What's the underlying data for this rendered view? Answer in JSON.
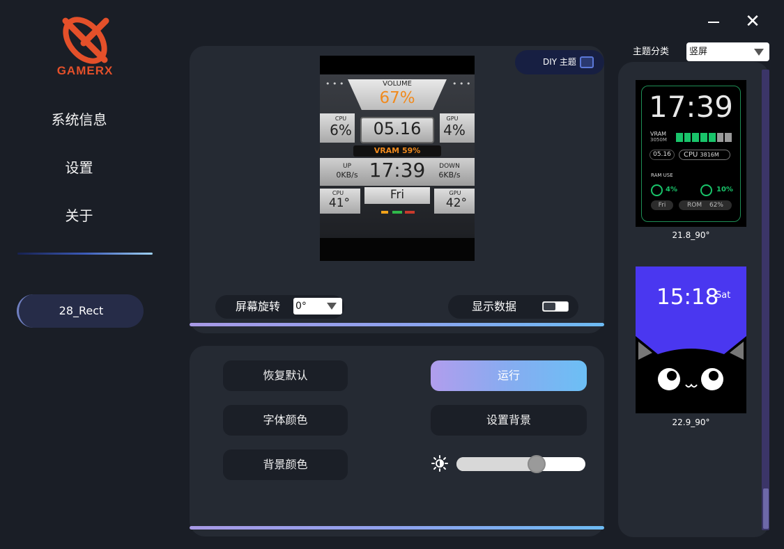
{
  "brand": {
    "name": "GAMERX",
    "color": "#e4502a"
  },
  "nav": {
    "items": [
      {
        "label": "系统信息"
      },
      {
        "label": "设置"
      },
      {
        "label": "关于"
      }
    ],
    "device": "28_Rect"
  },
  "window": {
    "minimize_icon": "minimize-icon",
    "close_icon": "close-icon",
    "close_glyph": "✕"
  },
  "preview": {
    "diy_label": "DIY 主题",
    "screen": {
      "volume_label": "VOLUME",
      "volume_value": "67%",
      "cpu_label": "CPU",
      "cpu_value": "6%",
      "date": "05.16",
      "gpu_label": "GPU",
      "gpu_value": "4%",
      "vram": "VRAM 59%",
      "up_label": "UP",
      "up_value": "0KB/s",
      "time": "17:39",
      "down_label": "DOWN",
      "down_value": "6KB/s",
      "cpu_temp_label": "CPU",
      "cpu_temp": "41°",
      "day": "Fri",
      "gpu_temp_label": "GPU",
      "gpu_temp": "42°"
    },
    "rotation_label": "屏幕旋转",
    "rotation_value": "0°",
    "show_data_label": "显示数据",
    "show_data_on": false
  },
  "controls": {
    "restore_default": "恢复默认",
    "run": "运行",
    "font_color": "字体颜色",
    "set_background": "设置背景",
    "bg_color": "背景颜色",
    "brightness": 0.62
  },
  "themes": {
    "category_label": "主题分类",
    "category_value": "竖屏",
    "items": [
      {
        "caption": "21.8_90°",
        "time": "17:39",
        "vram_label": "VRAM",
        "vram_sub": "3050M",
        "date": "05.16",
        "cpu": "CPU",
        "cpu_val": "3816M",
        "ram_use": "RAM USE",
        "pct1": "4%",
        "pct2": "10%",
        "day": "Fri",
        "rom": "ROM",
        "rom_val": "62%"
      },
      {
        "caption": "22.9_90°",
        "time": "15:18",
        "day": "Sat"
      }
    ]
  },
  "colors": {
    "accent": "#8fa2ee",
    "panel": "#252a33",
    "bg": "#1a1e26",
    "green": "#19c46a"
  }
}
